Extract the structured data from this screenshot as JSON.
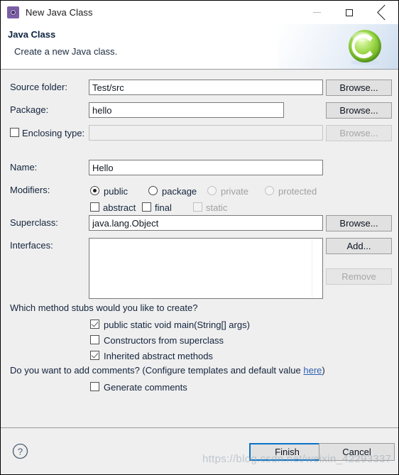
{
  "window": {
    "title": "New Java Class",
    "icon": "java-class-wizard-icon",
    "minimize_label": "—",
    "maximize_label": "□",
    "close_label": "✕"
  },
  "header": {
    "title": "Java Class",
    "description": "Create a new Java class.",
    "logo": "eclipse-c-logo"
  },
  "form": {
    "source_folder": {
      "label": "Source folder:",
      "value": "Test/src",
      "browse": "Browse...",
      "browse_enabled": true
    },
    "package": {
      "label": "Package:",
      "value": "hello",
      "browse": "Browse...",
      "browse_enabled": true
    },
    "enclosing_type": {
      "label": "Enclosing type:",
      "value": "",
      "checked": false,
      "browse": "Browse...",
      "browse_enabled": false
    },
    "name": {
      "label": "Name:",
      "value": "Hello"
    },
    "modifiers": {
      "label": "Modifiers:",
      "radios": [
        {
          "label": "public",
          "checked": true,
          "enabled": true
        },
        {
          "label": "package",
          "checked": false,
          "enabled": true
        },
        {
          "label": "private",
          "checked": false,
          "enabled": false
        },
        {
          "label": "protected",
          "checked": false,
          "enabled": false
        }
      ],
      "checkboxes": [
        {
          "label": "abstract",
          "checked": false,
          "enabled": true
        },
        {
          "label": "final",
          "checked": false,
          "enabled": true
        },
        {
          "label": "static",
          "checked": false,
          "enabled": false
        }
      ]
    },
    "superclass": {
      "label": "Superclass:",
      "value": "java.lang.Object",
      "browse": "Browse...",
      "browse_enabled": true
    },
    "interfaces": {
      "label": "Interfaces:",
      "items": [],
      "add": "Add...",
      "add_enabled": true,
      "remove": "Remove",
      "remove_enabled": false
    }
  },
  "stubs": {
    "question": "Which method stubs would you like to create?",
    "options": [
      {
        "label": "public static void main(String[] args)",
        "checked": true
      },
      {
        "label": "Constructors from superclass",
        "checked": false
      },
      {
        "label": "Inherited abstract methods",
        "checked": true
      }
    ]
  },
  "comments": {
    "question_prefix": "Do you want to add comments? (Configure templates and default value ",
    "link": "here",
    "question_suffix": ")",
    "option": {
      "label": "Generate comments",
      "checked": false
    }
  },
  "footer": {
    "help": "?",
    "finish": "Finish",
    "cancel": "Cancel"
  },
  "watermark": "https://blog.csdn.net/weixin_42293337"
}
